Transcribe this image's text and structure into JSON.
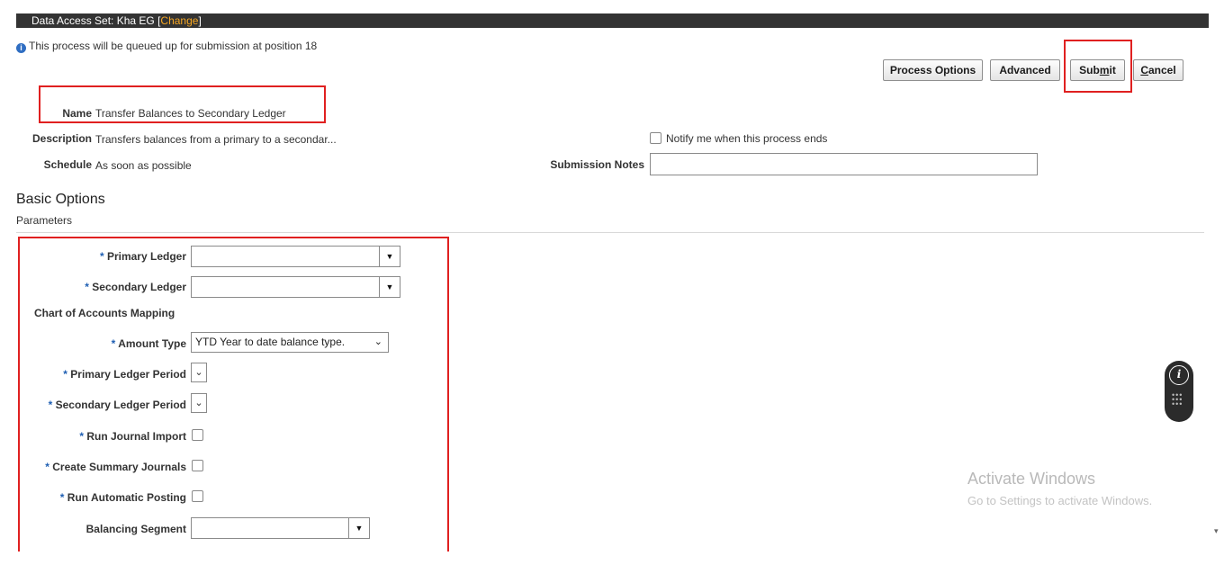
{
  "topbar": {
    "prefix": "Data Access Set: Kha EG [",
    "change_link": "Change",
    "suffix": "]"
  },
  "info": {
    "icon": "info-icon",
    "message": "This process will be queued up for submission at position 18"
  },
  "buttons": {
    "process_options": "Process Options",
    "advanced": "Advanced",
    "submit_pre": "Sub",
    "submit_mnemonic": "m",
    "submit_post": "it",
    "cancel_mnemonic": "C",
    "cancel_post": "ancel"
  },
  "header_fields": {
    "name_label": "Name",
    "name_value": "Transfer Balances to Secondary Ledger",
    "description_label": "Description",
    "description_value": "Transfers balances from a primary to a secondar...",
    "schedule_label": "Schedule",
    "schedule_value": "As soon as possible",
    "notify_label": "Notify me when this process ends",
    "notify_checked": false,
    "submission_notes_label": "Submission Notes",
    "submission_notes_value": ""
  },
  "section": {
    "title": "Basic Options",
    "subtitle": "Parameters"
  },
  "parameters": {
    "required_marker": "*",
    "primary_ledger_label": "Primary Ledger",
    "primary_ledger_value": "",
    "secondary_ledger_label": "Secondary Ledger",
    "secondary_ledger_value": "",
    "coa_mapping_label": "Chart of Accounts Mapping",
    "amount_type_label": "Amount Type",
    "amount_type_value": "YTD Year to date balance type.",
    "primary_period_label": "Primary Ledger Period",
    "secondary_period_label": "Secondary Ledger Period",
    "run_journal_import_label": "Run Journal Import",
    "create_summary_label": "Create Summary Journals",
    "run_auto_posting_label": "Run Automatic Posting",
    "balancing_segment_label": "Balancing Segment",
    "balancing_segment_value": ""
  },
  "watermark": {
    "line1": "Activate Windows",
    "line2": "Go to Settings to activate Windows."
  },
  "colors": {
    "topbar_bg": "#333333",
    "change_link": "#f5a623",
    "required_asterisk": "#1f5fb3",
    "highlight_box": "#e02020"
  }
}
